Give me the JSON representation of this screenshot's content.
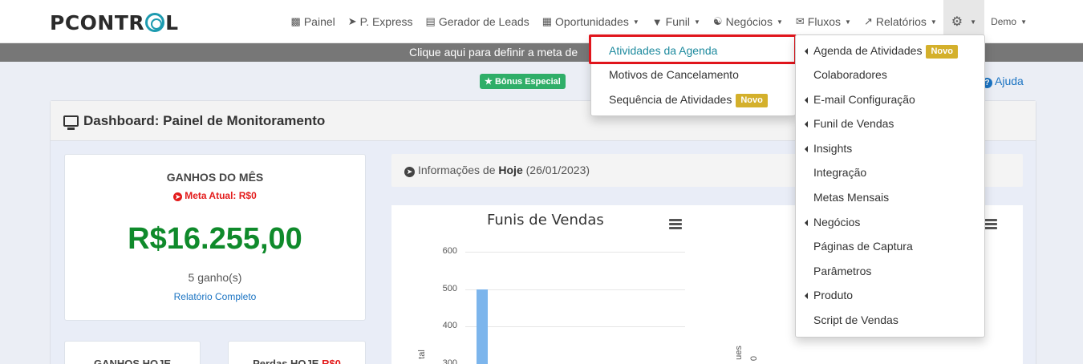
{
  "brand": {
    "logo_text_1": "PCONTR",
    "logo_text_2": "L"
  },
  "nav": {
    "items": [
      {
        "label": "Painel",
        "icon": "monitor-icon",
        "caret": false
      },
      {
        "label": "P. Express",
        "icon": "rocket-icon",
        "caret": false
      },
      {
        "label": "Gerador de Leads",
        "icon": "robot-icon",
        "caret": false
      },
      {
        "label": "Oportunidades",
        "icon": "list-icon",
        "caret": true
      },
      {
        "label": "Funil",
        "icon": "filter-icon",
        "caret": true
      },
      {
        "label": "Negócios",
        "icon": "handshake-icon",
        "caret": true
      },
      {
        "label": "Fluxos",
        "icon": "envelope-icon",
        "caret": true
      },
      {
        "label": "Relatórios",
        "icon": "line-chart-icon",
        "caret": true
      }
    ],
    "settings_icon": "gear-icon",
    "user": "Demo"
  },
  "infobar": {
    "text": "Clique aqui para definir a meta de"
  },
  "bonus": {
    "label": "Bônus Especial",
    "icon": "star-icon"
  },
  "help": {
    "label": "Ajuda",
    "icon": "question-icon"
  },
  "dashboard": {
    "title": "Dashboard: Painel de Monitoramento",
    "month_card": {
      "title": "GANHOS DO MÊS",
      "goal": "Meta Atual: R$0",
      "value": "R$16.255,00",
      "count": "5 ganho(s)",
      "report_link": "Relatório Completo"
    },
    "today_card": {
      "title": "GANHOS HOJE"
    },
    "lost_card": {
      "title": "Perdas HOJE",
      "value": "R$0"
    },
    "info": {
      "prefix": "Informações de",
      "bold": "Hoje",
      "date": "(26/01/2023)"
    }
  },
  "chart_data": {
    "type": "bar",
    "title": "Funis de Vendas",
    "ylabel": "tal",
    "yticks": [
      "600",
      "500",
      "400",
      "300"
    ],
    "ylim": [
      300,
      600
    ],
    "values": [
      500
    ],
    "second_chart_ylabel": "ues",
    "second_chart_tick": "0",
    "colors": {
      "bar": "#7cb5ec"
    }
  },
  "menu_left": {
    "items": [
      {
        "label": "Atividades da Agenda",
        "badge": "",
        "active": true
      },
      {
        "label": "Motivos de Cancelamento",
        "badge": ""
      },
      {
        "label": "Sequência de Atividades",
        "badge": "Novo"
      }
    ]
  },
  "menu_right": {
    "items": [
      {
        "label": "Agenda de Atividades",
        "submenu": true,
        "badge": "Novo"
      },
      {
        "label": "Colaboradores",
        "submenu": false,
        "badge": ""
      },
      {
        "label": "E-mail Configuração",
        "submenu": true,
        "badge": ""
      },
      {
        "label": "Funil de Vendas",
        "submenu": true,
        "badge": ""
      },
      {
        "label": "Insights",
        "submenu": true,
        "badge": ""
      },
      {
        "label": "Integração",
        "submenu": false,
        "badge": ""
      },
      {
        "label": "Metas Mensais",
        "submenu": false,
        "badge": ""
      },
      {
        "label": "Negócios",
        "submenu": true,
        "badge": ""
      },
      {
        "label": "Páginas de Captura",
        "submenu": false,
        "badge": ""
      },
      {
        "label": "Parâmetros",
        "submenu": false,
        "badge": ""
      },
      {
        "label": "Produto",
        "submenu": true,
        "badge": ""
      },
      {
        "label": "Script de Vendas",
        "submenu": false,
        "badge": ""
      }
    ]
  },
  "colors": {
    "accent": "#1d9bb0",
    "success": "#0f8a2b",
    "danger": "#e31b1b",
    "badge": "#d4b02b",
    "bonus": "#2fae68",
    "link": "#1a73c2"
  }
}
